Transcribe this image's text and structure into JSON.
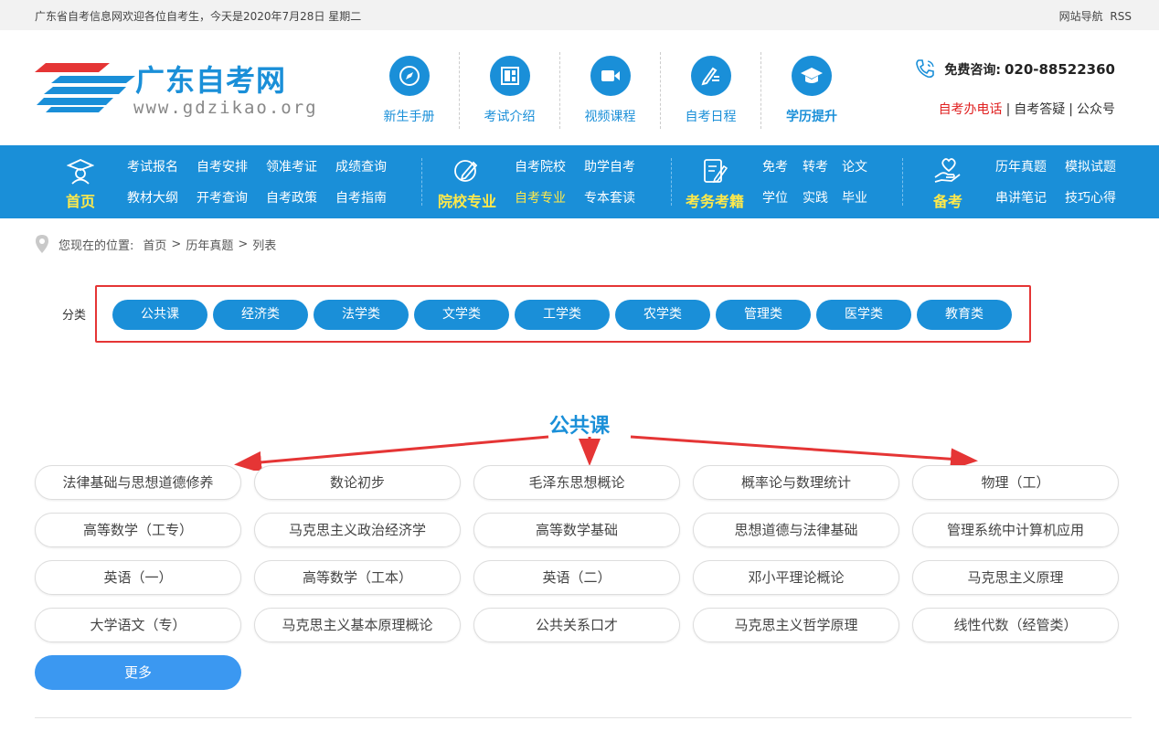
{
  "topbar": {
    "welcome": "广东省自考信息网欢迎各位自考生，今天是2020年7月28日 星期二",
    "sitemap": "网站导航",
    "rss": "RSS"
  },
  "logo": {
    "name": "广东自考网",
    "domain": "www.gdzikao.org"
  },
  "quicknav": [
    {
      "label": "新生手册",
      "icon": "compass-icon"
    },
    {
      "label": "考试介绍",
      "icon": "layout-icon"
    },
    {
      "label": "视频课程",
      "icon": "video-camera-icon"
    },
    {
      "label": "自考日程",
      "icon": "pencil-list-icon"
    },
    {
      "label": "学历提升",
      "icon": "graduation-cap-icon"
    }
  ],
  "contact": {
    "label": "免费咨询:",
    "phone": "020-88522360",
    "links": [
      "自考办电话",
      "自考答疑",
      "公众号"
    ]
  },
  "mainnav": {
    "groups": [
      {
        "title": "首页",
        "links": [
          "考试报名",
          "自考安排",
          "领准考证",
          "成绩查询",
          "教材大纲",
          "开考查询",
          "自考政策",
          "自考指南"
        ]
      },
      {
        "title": "院校专业",
        "links": [
          "自考院校",
          "助学自考",
          "自考专业",
          "专本套读"
        ]
      },
      {
        "title": "考务考籍",
        "links": [
          "免考",
          "转考",
          "论文",
          "学位",
          "实践",
          "毕业"
        ]
      },
      {
        "title": "备考",
        "links": [
          "历年真题",
          "模拟试题",
          "串讲笔记",
          "技巧心得"
        ]
      }
    ]
  },
  "breadcrumb": {
    "prefix": "您现在的位置:",
    "items": [
      "首页",
      "历年真题",
      "列表"
    ],
    "separator": ">"
  },
  "categories": {
    "label": "分类",
    "items": [
      "公共课",
      "经济类",
      "法学类",
      "文学类",
      "工学类",
      "农学类",
      "管理类",
      "医学类",
      "教育类"
    ]
  },
  "section": {
    "title": "公共课",
    "courses": [
      "法律基础与思想道德修养",
      "数论初步",
      "毛泽东思想概论",
      "概率论与数理统计",
      "物理（工）",
      "高等数学（工专）",
      "马克思主义政治经济学",
      "高等数学基础",
      "思想道德与法律基础",
      "管理系统中计算机应用",
      "英语（一）",
      "高等数学（工本）",
      "英语（二）",
      "邓小平理论概论",
      "马克思主义原理",
      "大学语文（专）",
      "马克思主义基本原理概论",
      "公共关系口才",
      "马克思主义哲学原理",
      "线性代数（经管类）"
    ],
    "more": "更多"
  },
  "colors": {
    "primary": "#1a8fd8",
    "highlight": "#ffe94a",
    "annotation": "#e53535"
  }
}
